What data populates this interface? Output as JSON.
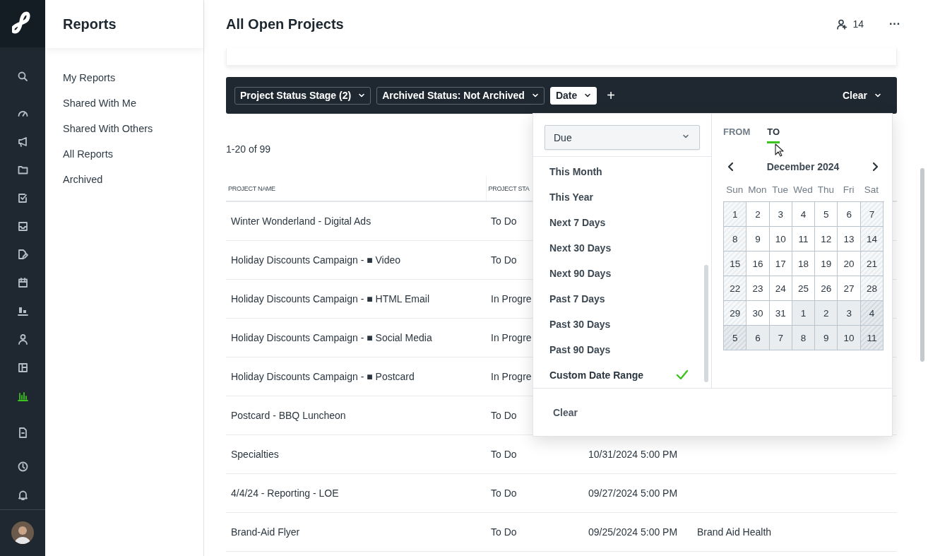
{
  "rail": {
    "items": [
      {
        "selected": false
      },
      {
        "selected": false
      },
      {
        "selected": false
      },
      {
        "selected": false
      },
      {
        "selected": false
      },
      {
        "selected": false
      },
      {
        "selected": false
      },
      {
        "selected": false
      },
      {
        "selected": false
      },
      {
        "selected": false
      },
      {
        "selected": false
      },
      {
        "selected": true
      },
      {
        "selected": false
      },
      {
        "selected": false
      },
      {
        "selected": false
      }
    ]
  },
  "sidebar": {
    "title": "Reports",
    "items": [
      {
        "label": "My Reports",
        "selected": false
      },
      {
        "label": "Shared With Me",
        "selected": false
      },
      {
        "label": "Shared With Others",
        "selected": false
      },
      {
        "label": "All Reports",
        "selected": false
      },
      {
        "label": "Archived",
        "selected": false
      }
    ]
  },
  "header": {
    "title": "All Open Projects",
    "members": "14",
    "more": "···"
  },
  "filters": {
    "chips": [
      {
        "label": "Project Status Stage (2)",
        "open": false
      },
      {
        "label": "Archived Status: Not Archived",
        "open": false
      },
      {
        "label": "Date",
        "open": true
      }
    ],
    "add": "+",
    "clear": "Clear"
  },
  "count": "1-20 of 99",
  "table": {
    "columns": [
      "PROJECT NAME",
      "PROJECT STA"
    ],
    "rows": [
      {
        "name": "Winter Wonderland - Digital Ads",
        "status": "To Do"
      },
      {
        "name": "Holiday Discounts Campaign - ■ Video",
        "status": "To Do"
      },
      {
        "name": "Holiday Discounts Campaign - ■ HTML Email",
        "status": "In Progre"
      },
      {
        "name": "Holiday Discounts Campaign - ■ Social Media",
        "status": "In Progre"
      },
      {
        "name": "Holiday Discounts Campaign - ■ Postcard",
        "status": "In Progre"
      },
      {
        "name": "Postcard - BBQ Luncheon",
        "status": "To Do"
      },
      {
        "name": "Specialties",
        "status": "To Do",
        "due": "10/31/2024 5:00 PM"
      },
      {
        "name": "4/4/24 - Reporting - LOE",
        "status": "To Do",
        "due": "09/27/2024 5:00 PM"
      },
      {
        "name": "Brand-Aid Flyer",
        "status": "To Do",
        "due": "09/25/2024 5:00 PM",
        "client": "Brand Aid Health"
      }
    ]
  },
  "date_popover": {
    "field": {
      "value": "Due"
    },
    "options": [
      {
        "label": "This Month",
        "selected": false
      },
      {
        "label": "This Year",
        "selected": false
      },
      {
        "label": "Next 7 Days",
        "selected": false
      },
      {
        "label": "Next 30 Days",
        "selected": false
      },
      {
        "label": "Next 90 Days",
        "selected": false
      },
      {
        "label": "Past 7 Days",
        "selected": false
      },
      {
        "label": "Past 30 Days",
        "selected": false
      },
      {
        "label": "Past 90 Days",
        "selected": false
      },
      {
        "label": "Custom Date Range",
        "selected": true
      }
    ],
    "tabs": [
      {
        "label": "FROM",
        "selected": false
      },
      {
        "label": "TO",
        "selected": true
      }
    ],
    "calendar": {
      "month": "December 2024",
      "weekdays": [
        "Sun",
        "Mon",
        "Tue",
        "Wed",
        "Thu",
        "Fri",
        "Sat"
      ],
      "weeks": [
        [
          {
            "day": "1",
            "other_month": false
          },
          {
            "day": "2",
            "other_month": false
          },
          {
            "day": "3",
            "other_month": false
          },
          {
            "day": "4",
            "other_month": false
          },
          {
            "day": "5",
            "other_month": false
          },
          {
            "day": "6",
            "other_month": false
          },
          {
            "day": "7",
            "other_month": false
          }
        ],
        [
          {
            "day": "8",
            "other_month": false
          },
          {
            "day": "9",
            "other_month": false
          },
          {
            "day": "10",
            "other_month": false
          },
          {
            "day": "11",
            "other_month": false
          },
          {
            "day": "12",
            "other_month": false
          },
          {
            "day": "13",
            "other_month": false
          },
          {
            "day": "14",
            "other_month": false
          }
        ],
        [
          {
            "day": "15",
            "other_month": false
          },
          {
            "day": "16",
            "other_month": false
          },
          {
            "day": "17",
            "other_month": false
          },
          {
            "day": "18",
            "other_month": false
          },
          {
            "day": "19",
            "other_month": false
          },
          {
            "day": "20",
            "other_month": false
          },
          {
            "day": "21",
            "other_month": false
          }
        ],
        [
          {
            "day": "22",
            "other_month": false
          },
          {
            "day": "23",
            "other_month": false
          },
          {
            "day": "24",
            "other_month": false
          },
          {
            "day": "25",
            "other_month": false
          },
          {
            "day": "26",
            "other_month": false
          },
          {
            "day": "27",
            "other_month": false
          },
          {
            "day": "28",
            "other_month": false
          }
        ],
        [
          {
            "day": "29",
            "other_month": false
          },
          {
            "day": "30",
            "other_month": false
          },
          {
            "day": "31",
            "other_month": false
          },
          {
            "day": "1",
            "other_month": true
          },
          {
            "day": "2",
            "other_month": true
          },
          {
            "day": "3",
            "other_month": true
          },
          {
            "day": "4",
            "other_month": true
          }
        ],
        [
          {
            "day": "5",
            "other_month": true
          },
          {
            "day": "6",
            "other_month": true
          },
          {
            "day": "7",
            "other_month": true
          },
          {
            "day": "8",
            "other_month": true
          },
          {
            "day": "9",
            "other_month": true
          },
          {
            "day": "10",
            "other_month": true
          },
          {
            "day": "11",
            "other_month": true
          }
        ]
      ]
    },
    "clear": "Clear"
  }
}
